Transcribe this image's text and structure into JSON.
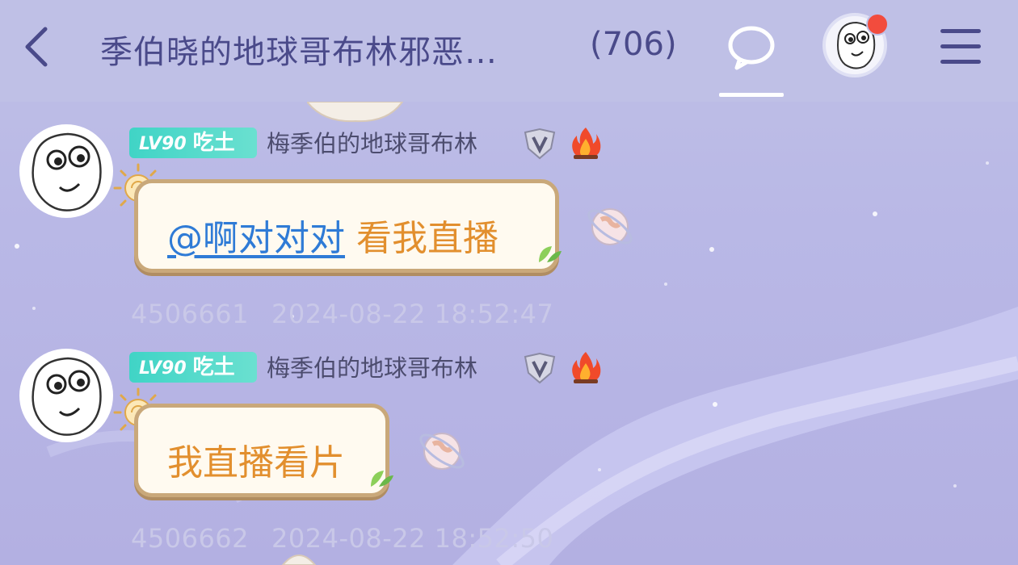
{
  "header": {
    "title": "季伯晓的地球哥布林邪恶…",
    "member_count": "(706)"
  },
  "colors": {
    "header_bg": "#bfc0e6",
    "title_text": "#4a4a8a",
    "badge_teal": "#40d4c6",
    "bubble_text": "#e28f2e",
    "mention_blue": "#2f7bd6",
    "notification_red": "#f24c3d"
  },
  "messages": [
    {
      "level": "LV90",
      "title_tag": "吃土",
      "username": "梅季伯的地球哥布林",
      "mention": "@啊对对对",
      "text": "看我直播",
      "message_id": "4506661",
      "timestamp": "2024-08-22 18:52:47"
    },
    {
      "level": "LV90",
      "title_tag": "吃土",
      "username": "梅季伯的地球哥布林",
      "mention": "",
      "text": "我直播看片",
      "message_id": "4506662",
      "timestamp": "2024-08-22 18:52:50"
    }
  ],
  "icons": {
    "back": "chevron-left-icon",
    "chat": "chat-bubble-icon",
    "menu": "hamburger-menu-icon",
    "vip": "shield-v-icon",
    "fire": "fire-icon",
    "sun": "sun-icon",
    "planet": "planet-icon"
  }
}
